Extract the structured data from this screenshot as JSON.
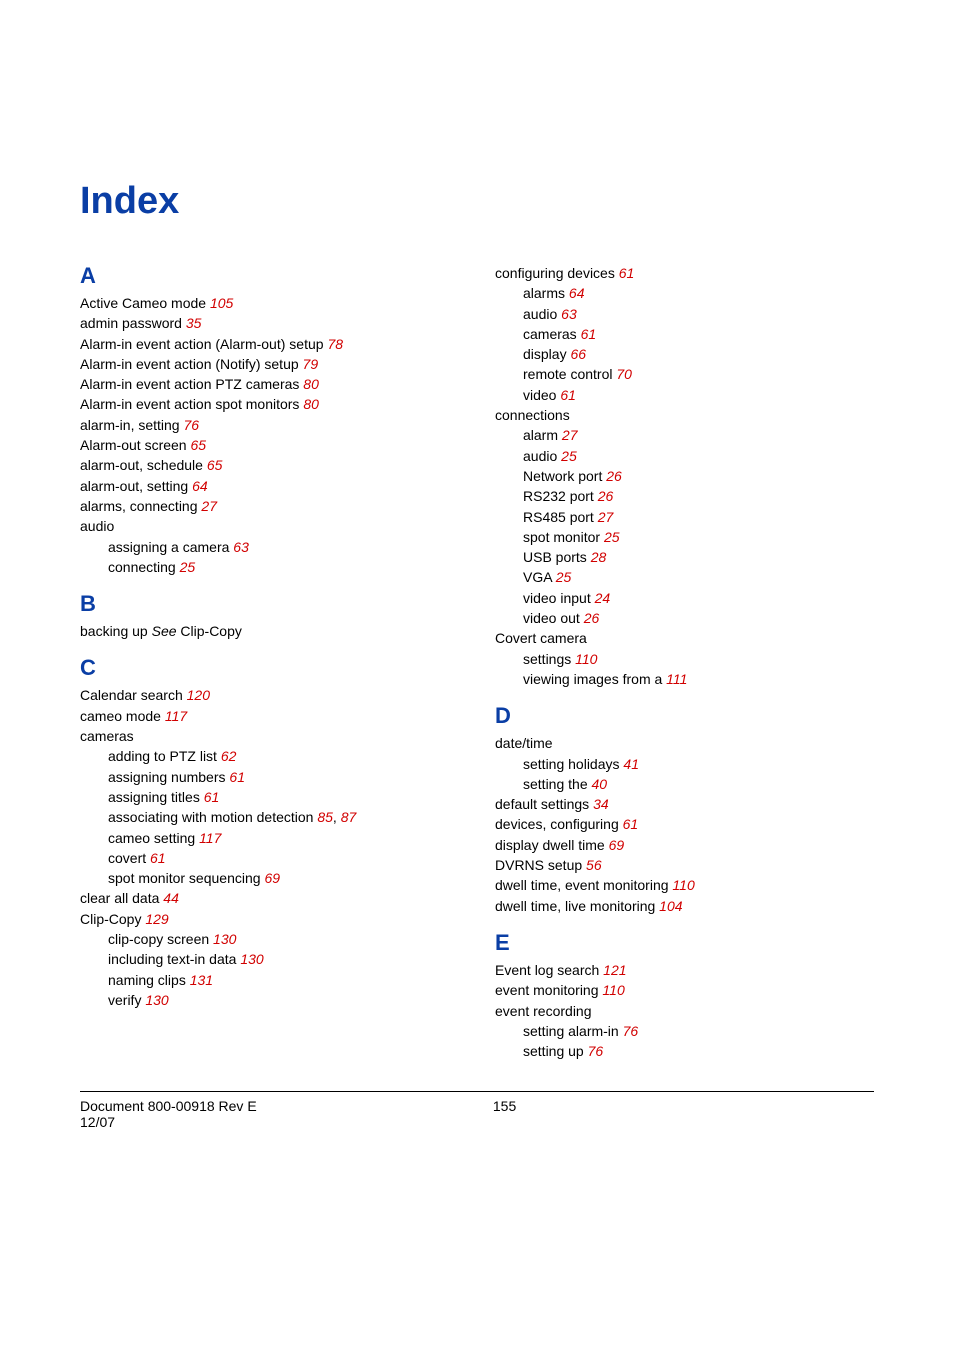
{
  "page_title": "Index",
  "footer": {
    "left_line1": "Document 800-00918 Rev E",
    "left_line2": "12/07",
    "right": "155"
  },
  "left_sections": [
    {
      "heading": "A",
      "entries": [
        {
          "text": "Active Cameo mode ",
          "page": "105"
        },
        {
          "text": "admin password ",
          "page": "35"
        },
        {
          "text": "Alarm-in event action (Alarm-out) setup ",
          "page": "78"
        },
        {
          "text": "Alarm-in event action (Notify) setup ",
          "page": "79"
        },
        {
          "text": "Alarm-in event action PTZ cameras ",
          "page": "80"
        },
        {
          "text": "Alarm-in event action spot monitors ",
          "page": "80"
        },
        {
          "text": "alarm-in, setting ",
          "page": "76"
        },
        {
          "text": "Alarm-out screen ",
          "page": "65"
        },
        {
          "text": "alarm-out, schedule ",
          "page": "65"
        },
        {
          "text": "alarm-out, setting ",
          "page": "64"
        },
        {
          "text": "alarms, connecting ",
          "page": "27"
        },
        {
          "text": "audio",
          "page": ""
        },
        {
          "text": "assigning a camera ",
          "page": "63",
          "sub": true
        },
        {
          "text": "connecting ",
          "page": "25",
          "sub": true
        }
      ]
    },
    {
      "heading": "B",
      "entries": [
        {
          "text_pre": "backing up ",
          "cross": "See",
          "text_post": " Clip-Copy",
          "page": ""
        }
      ]
    },
    {
      "heading": "C",
      "entries": [
        {
          "text": "Calendar search ",
          "page": "120"
        },
        {
          "text": "cameo mode ",
          "page": "117"
        },
        {
          "text": "cameras",
          "page": ""
        },
        {
          "text": "adding to PTZ list ",
          "page": "62",
          "sub": true
        },
        {
          "text": "assigning numbers ",
          "page": "61",
          "sub": true
        },
        {
          "text": "assigning titles ",
          "page": "61",
          "sub": true
        },
        {
          "text": "associating with motion detection ",
          "page": "85",
          "page2": "87",
          "sub": true
        },
        {
          "text": "cameo setting ",
          "page": "117",
          "sub": true
        },
        {
          "text": "covert ",
          "page": "61",
          "sub": true
        },
        {
          "text": "spot monitor sequencing ",
          "page": "69",
          "sub": true
        },
        {
          "text": "clear all data ",
          "page": "44"
        },
        {
          "text": "Clip-Copy ",
          "page": "129"
        },
        {
          "text": "clip-copy screen ",
          "page": "130",
          "sub": true
        },
        {
          "text": "including text-in data ",
          "page": "130",
          "sub": true
        },
        {
          "text": "naming clips ",
          "page": "131",
          "sub": true
        },
        {
          "text": "verify ",
          "page": "130",
          "sub": true
        }
      ]
    }
  ],
  "right_sections": [
    {
      "heading": "",
      "entries": [
        {
          "text": "configuring devices ",
          "page": "61"
        },
        {
          "text": "alarms ",
          "page": "64",
          "sub": true
        },
        {
          "text": "audio ",
          "page": "63",
          "sub": true
        },
        {
          "text": "cameras ",
          "page": "61",
          "sub": true
        },
        {
          "text": "display ",
          "page": "66",
          "sub": true
        },
        {
          "text": "remote control ",
          "page": "70",
          "sub": true
        },
        {
          "text": "video ",
          "page": "61",
          "sub": true
        },
        {
          "text": "connections",
          "page": ""
        },
        {
          "text": "alarm ",
          "page": "27",
          "sub": true
        },
        {
          "text": "audio ",
          "page": "25",
          "sub": true
        },
        {
          "text": "Network port ",
          "page": "26",
          "sub": true
        },
        {
          "text": "RS232 port ",
          "page": "26",
          "sub": true
        },
        {
          "text": "RS485 port ",
          "page": "27",
          "sub": true
        },
        {
          "text": "spot monitor ",
          "page": "25",
          "sub": true
        },
        {
          "text": "USB ports ",
          "page": "28",
          "sub": true
        },
        {
          "text": "VGA ",
          "page": "25",
          "sub": true
        },
        {
          "text": "video input ",
          "page": "24",
          "sub": true
        },
        {
          "text": "video out ",
          "page": "26",
          "sub": true
        },
        {
          "text": "Covert camera",
          "page": ""
        },
        {
          "text": "settings ",
          "page": "110",
          "sub": true
        },
        {
          "text": "viewing images from a ",
          "page": "111",
          "sub": true
        }
      ]
    },
    {
      "heading": "D",
      "entries": [
        {
          "text": "date/time",
          "page": ""
        },
        {
          "text": "setting holidays ",
          "page": "41",
          "sub": true
        },
        {
          "text": "setting the ",
          "page": "40",
          "sub": true
        },
        {
          "text": "default settings ",
          "page": "34"
        },
        {
          "text": "devices, configuring ",
          "page": "61"
        },
        {
          "text": "display dwell time ",
          "page": "69"
        },
        {
          "text": "DVRNS setup ",
          "page": "56"
        },
        {
          "text": "dwell time, event monitoring ",
          "page": "110"
        },
        {
          "text": "dwell time, live monitoring ",
          "page": "104"
        }
      ]
    },
    {
      "heading": "E",
      "entries": [
        {
          "text": "Event log search ",
          "page": "121"
        },
        {
          "text": "event monitoring ",
          "page": "110"
        },
        {
          "text": "event recording",
          "page": ""
        },
        {
          "text": "setting alarm-in ",
          "page": "76",
          "sub": true
        },
        {
          "text": "setting up ",
          "page": "76",
          "sub": true
        }
      ]
    }
  ]
}
